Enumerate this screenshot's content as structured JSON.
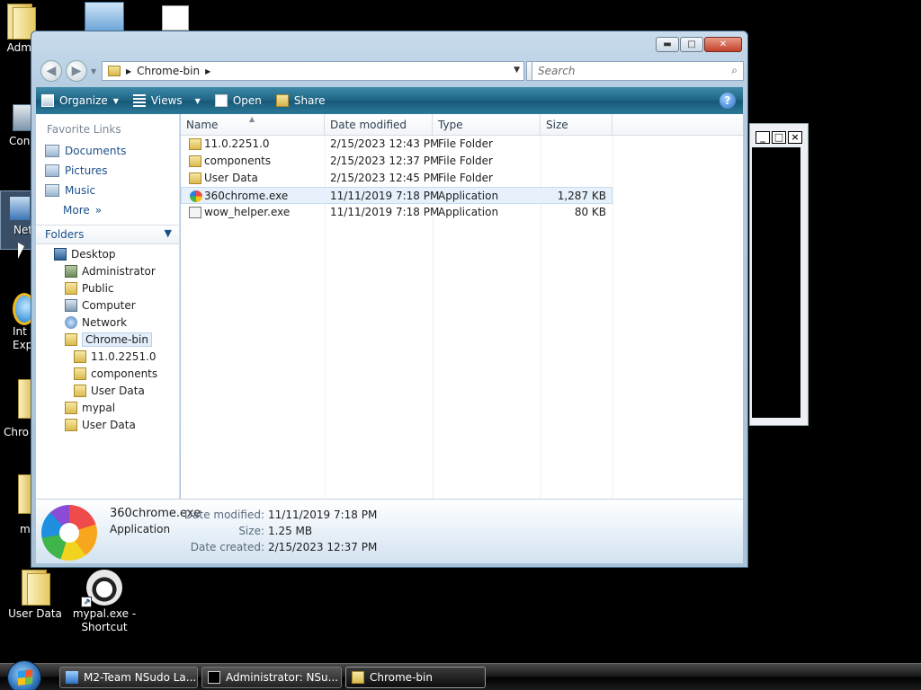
{
  "desktop": {
    "icons": [
      {
        "label": "Admi"
      },
      {
        "label": "Con"
      },
      {
        "label": "Net"
      },
      {
        "label": "Int Exp"
      },
      {
        "label": "Chro"
      },
      {
        "label": "m"
      },
      {
        "label": "User Data"
      },
      {
        "label": "mypal.exe - Shortcut"
      }
    ]
  },
  "window": {
    "address": {
      "path": "Chrome-bin"
    },
    "search_placeholder": "Search",
    "toolbar": {
      "organize": "Organize",
      "views": "Views",
      "open": "Open",
      "share": "Share"
    },
    "favorites": {
      "header": "Favorite Links",
      "items": [
        "Documents",
        "Pictures",
        "Music"
      ],
      "more": "More"
    },
    "folders_header": "Folders",
    "tree": [
      "Desktop",
      "Administrator",
      "Public",
      "Computer",
      "Network",
      "Chrome-bin",
      "11.0.2251.0",
      "components",
      "User Data",
      "mypal",
      "User Data"
    ],
    "columns": {
      "name": "Name",
      "date": "Date modified",
      "type": "Type",
      "size": "Size"
    },
    "files": [
      {
        "name": "11.0.2251.0",
        "date": "2/15/2023 12:43 PM",
        "type": "File Folder",
        "size": ""
      },
      {
        "name": "components",
        "date": "2/15/2023 12:37 PM",
        "type": "File Folder",
        "size": ""
      },
      {
        "name": "User Data",
        "date": "2/15/2023 12:45 PM",
        "type": "File Folder",
        "size": ""
      },
      {
        "name": "360chrome.exe",
        "date": "11/11/2019 7:18 PM",
        "type": "Application",
        "size": "1,287 KB"
      },
      {
        "name": "wow_helper.exe",
        "date": "11/11/2019 7:18 PM",
        "type": "Application",
        "size": "80 KB"
      }
    ],
    "details": {
      "name": "360chrome.exe",
      "type": "Application",
      "date_modified_label": "Date modified:",
      "date_modified": "11/11/2019 7:18 PM",
      "size_label": "Size:",
      "size": "1.25 MB",
      "date_created_label": "Date created:",
      "date_created": "2/15/2023 12:37 PM"
    }
  },
  "taskbar": {
    "items": [
      "M2-Team NSudo La...",
      "Administrator: NSu...",
      "Chrome-bin"
    ]
  },
  "colors": {
    "toolbar": "#1f6383",
    "selection": "#e6f1fb",
    "link": "#1c4f8a"
  }
}
